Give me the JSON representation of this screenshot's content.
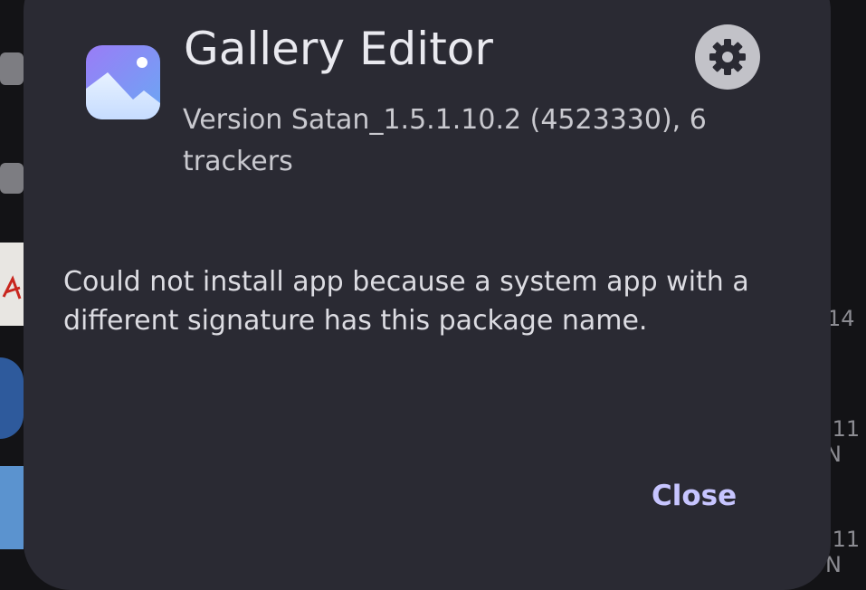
{
  "background": {
    "row_labels": [
      "14",
      ".11 N",
      ".11 N"
    ]
  },
  "dialog": {
    "app_name": "Gallery Editor",
    "version_text": "Version Satan_1.5.1.10.2 (4523330), 6 trackers",
    "message": "Could not install app because a system app with a different signature has this package name.",
    "close_label": "Close",
    "settings_icon": "gear-icon",
    "app_icon": "gallery-icon"
  },
  "colors": {
    "dialog_bg": "#2a2a33",
    "accent": "#c7c5ff",
    "gear_bg": "#c2c2c8"
  }
}
